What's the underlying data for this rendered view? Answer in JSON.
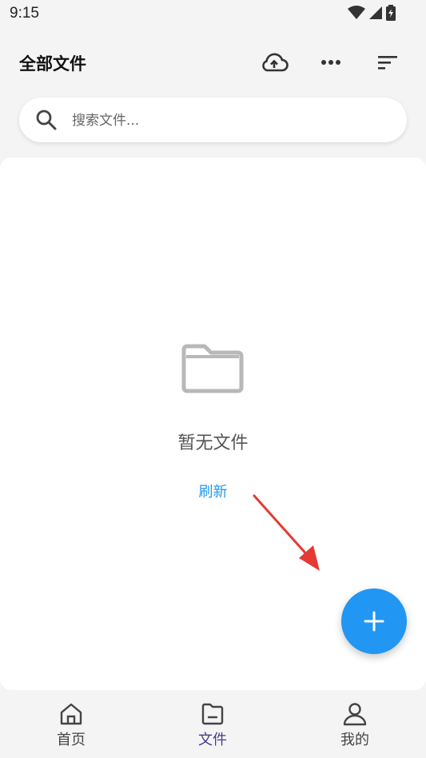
{
  "status": {
    "time": "9:15"
  },
  "header": {
    "title": "全部文件"
  },
  "search": {
    "placeholder": "搜索文件..."
  },
  "empty": {
    "message": "暂无文件",
    "refresh": "刷新"
  },
  "nav": [
    {
      "label": "首页",
      "icon": "home-icon"
    },
    {
      "label": "文件",
      "icon": "folder-icon",
      "active": true
    },
    {
      "label": "我的",
      "icon": "person-icon"
    }
  ],
  "colors": {
    "accent": "#2196f3",
    "nav_active": "#4a3a8c",
    "annotation_arrow": "#e53935"
  }
}
